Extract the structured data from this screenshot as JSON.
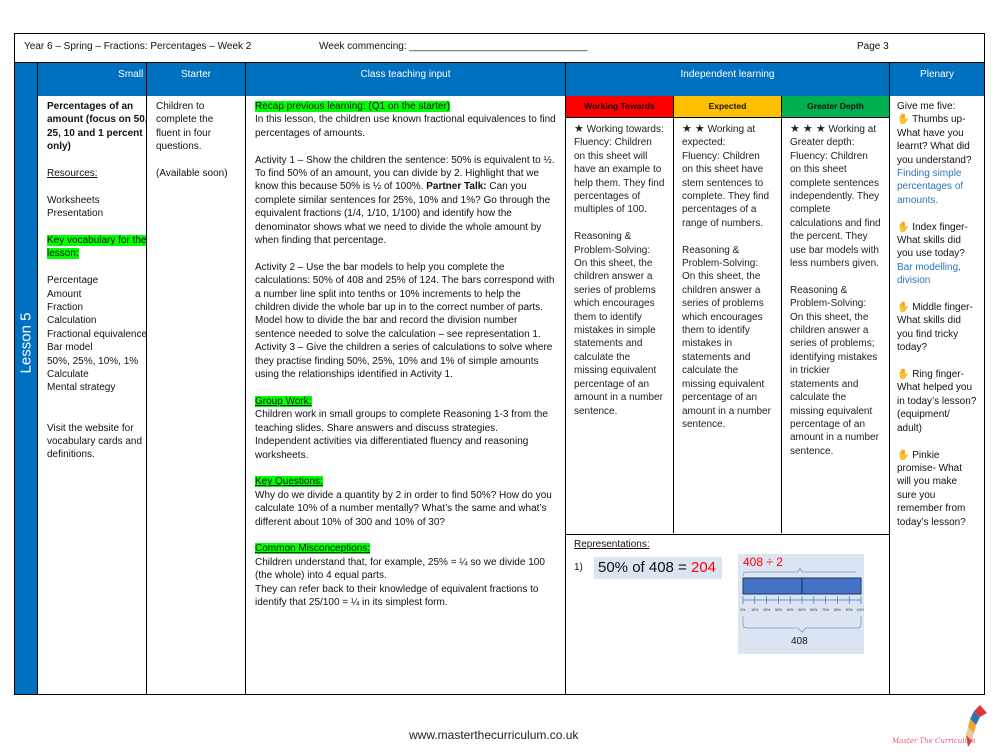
{
  "header": {
    "title": "Year 6 – Spring – Fractions: Percentages – Week 2",
    "week_commencing": "Week commencing: ________________________________",
    "page": "Page 3"
  },
  "columns": {
    "small_step": "Small step",
    "starter": "Starter",
    "class_teaching": "Class teaching input",
    "independent": "Independent learning",
    "plenary": "Plenary"
  },
  "lesson_label": "Lesson 5",
  "small_step": {
    "title": "Percentages of an amount (focus on 50, 25, 10 and 1 percent only)",
    "resources_label": "Resources:",
    "resources": [
      "Worksheets",
      "Presentation"
    ],
    "vocab_label": "Key vocabulary for the lesson:",
    "vocab": [
      "Percentage",
      "Amount",
      "Fraction",
      "Calculation",
      "Fractional equivalences",
      "Bar model",
      "50%, 25%, 10%, 1%",
      "Calculate",
      "Mental strategy"
    ],
    "visit": "Visit the website for vocabulary cards and definitions."
  },
  "starter": {
    "text": "Children to complete the fluent in four questions.",
    "note": "(Available soon)"
  },
  "teaching": {
    "recap_label": "Recap previous learning: (Q1 on the starter)",
    "intro": "In this lesson, the children use known fractional equivalences to find percentages of amounts.",
    "activity1_a": "Activity 1 – Show the children the sentence: 50% is equivalent to ½. To find 50% of an amount, you can divide by 2. Highlight that we know this because 50% is ½ of 100%. ",
    "partner_talk": "Partner Talk:",
    "activity1_b": " Can you complete similar sentences for 25%, 10% and 1%?  Go through the equivalent fractions (1/4, 1/10, 1/100) and identify how the denominator shows what we need to divide the whole amount by when finding that percentage.",
    "activity2": "Activity 2 – Use the bar models to help you complete the calculations: 50% of 408 and 25% of 124. The bars correspond with a number line split into tenths or 10% increments to help the children divide the whole bar up in to the correct number of parts. Model how to divide the bar and record the division number sentence needed to solve the calculation – see representation 1.",
    "activity3": "Activity 3 – Give the children a series of calculations to solve where they practise finding 50%, 25%, 10% and 1% of simple amounts using the relationships identified in Activity 1.",
    "group_label": "Group Work:",
    "group": "Children work in small groups to complete Reasoning 1-3 from the teaching slides. Share answers and discuss strategies.",
    "independent": "Independent activities via differentiated fluency and reasoning worksheets.",
    "kq_label": "Key Questions:",
    "kq": "Why do we divide a quantity by 2 in order to find 50%? How do you calculate 10% of a number mentally? What’s the same and what’s different about 10% of 300 and 10% of 30?",
    "misc_label": "Common Misconceptions:",
    "misc1": "Children understand that, for example, 25% = ¼ so we divide 100 (the whole) into 4 equal parts.",
    "misc2": "They can refer back to their knowledge of equivalent fractions to identify that 25/100 = ¼ in its simplest form."
  },
  "independent": {
    "levels": [
      {
        "label": "Working Towards",
        "color": "#ff0000",
        "stars": "★",
        "title": "Working towards:",
        "fluency": "Fluency: Children on this sheet will have an example to help them. They find percentages of multiples of 100.",
        "rps_label": "Reasoning & Problem-Solving:",
        "rps": "On this sheet, the children answer a series of problems which encourages them to identify mistakes in simple statements and calculate the missing equivalent percentage of an amount in a number sentence."
      },
      {
        "label": "Expected",
        "color": "#ffc000",
        "stars": "★ ★",
        "title": "Working at expected:",
        "fluency": "Fluency: Children on this sheet have stem sentences to complete. They find percentages of a range of numbers.",
        "rps_label": "Reasoning & Problem-Solving:",
        "rps": "On this sheet, the children answer a series of problems which encourages them to identify mistakes in statements and calculate the missing equivalent percentage of an amount in a number sentence."
      },
      {
        "label": "Greater Depth",
        "color": "#00b050",
        "stars": "★ ★ ★",
        "title": "Working at Greater depth:",
        "fluency": "Fluency: Children on this sheet complete sentences independently. They complete calculations and find the percent. They use bar models with less numbers given.",
        "rps_label": "Reasoning & Problem-Solving:",
        "rps": "On this sheet, the children answer a series of problems; identifying mistakes in trickier statements and calculate the missing equivalent percentage of an amount in a number sentence."
      }
    ],
    "representations_label": "Representations:",
    "rep_number": "1)",
    "rep_eq": "50% of 408 = ",
    "rep_answer": "204",
    "bar_division": "408 ÷ 2",
    "bar_total": "408",
    "bar_ticks": [
      "0%",
      "10%",
      "20%",
      "30%",
      "40%",
      "50%",
      "60%",
      "70%",
      "80%",
      "90%",
      "100%"
    ]
  },
  "plenary": {
    "intro": "Give me five:",
    "items": [
      {
        "q": "Thumbs up- What have you learnt? What did you understand?",
        "a": "Finding simple percentages of amounts."
      },
      {
        "q": "Index finger- What skills did you use today?",
        "a": "Bar modelling, division"
      },
      {
        "q": "Middle finger- What skills did you find tricky today?",
        "a": ""
      },
      {
        "q": "Ring finger- What helped you in today’s lesson? (equipment/ adult)",
        "a": ""
      },
      {
        "q": "Pinkie promise- What will you make sure you remember from today’s lesson?",
        "a": ""
      }
    ]
  },
  "footer": {
    "url": "www.masterthecurriculum.co.uk",
    "logo_text": "Master The Curriculum"
  }
}
